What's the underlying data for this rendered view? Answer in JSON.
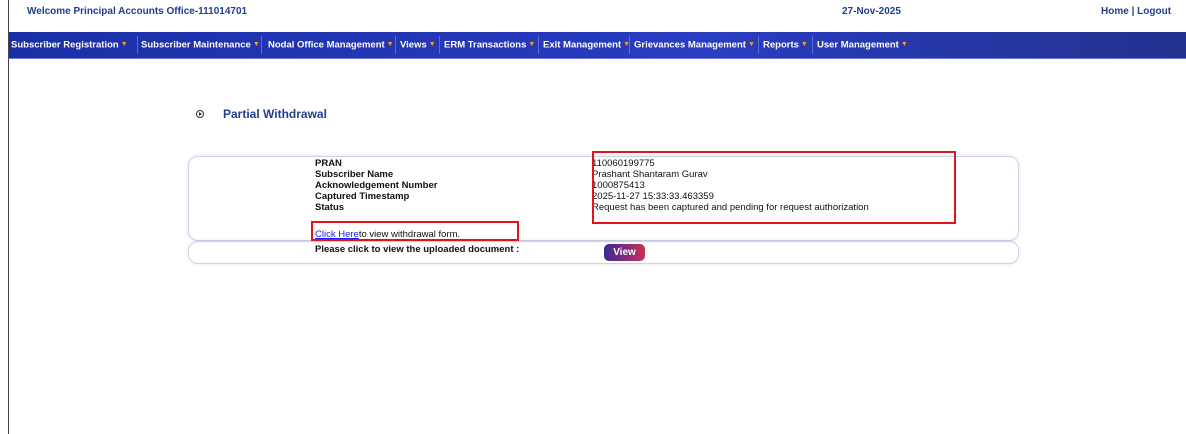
{
  "header": {
    "welcome": "Welcome Principal Accounts Office-111014701",
    "date": "27-Nov-2025",
    "home_link": "Home",
    "separator": " | ",
    "logout_link": "Logout"
  },
  "nav": {
    "caret_color": "#ff9a1a",
    "items": [
      {
        "label": "Subscriber Registration"
      },
      {
        "label": "Subscriber Maintenance"
      },
      {
        "label": "Nodal Office Management"
      },
      {
        "label": "Views"
      },
      {
        "label": "ERM Transactions"
      },
      {
        "label": "Exit Management"
      },
      {
        "label": "Grievances Management"
      },
      {
        "label": "Reports"
      },
      {
        "label": "User Management"
      }
    ]
  },
  "section": {
    "title": "Partial Withdrawal"
  },
  "details": {
    "fields": [
      {
        "label": "PRAN",
        "value": "110060199775"
      },
      {
        "label": "Subscriber Name",
        "value": "Prashant Shantaram Gurav"
      },
      {
        "label": "Acknowledgement Number",
        "value": "1000875413"
      },
      {
        "label": "Captured Timestamp",
        "value": "2025-11-27 15:33:33.463359"
      },
      {
        "label": "Status",
        "value": "Request has been captured and pending for request authorization"
      }
    ],
    "link_text": "Click Here",
    "link_suffix": "to view withdrawal form.",
    "upload_label": "Please click to view the uploaded document :",
    "view_button": "View"
  },
  "colors": {
    "nav_background": "#2a3cc0",
    "header_text": "#1f3f8f",
    "highlight_border": "#e3131b"
  }
}
